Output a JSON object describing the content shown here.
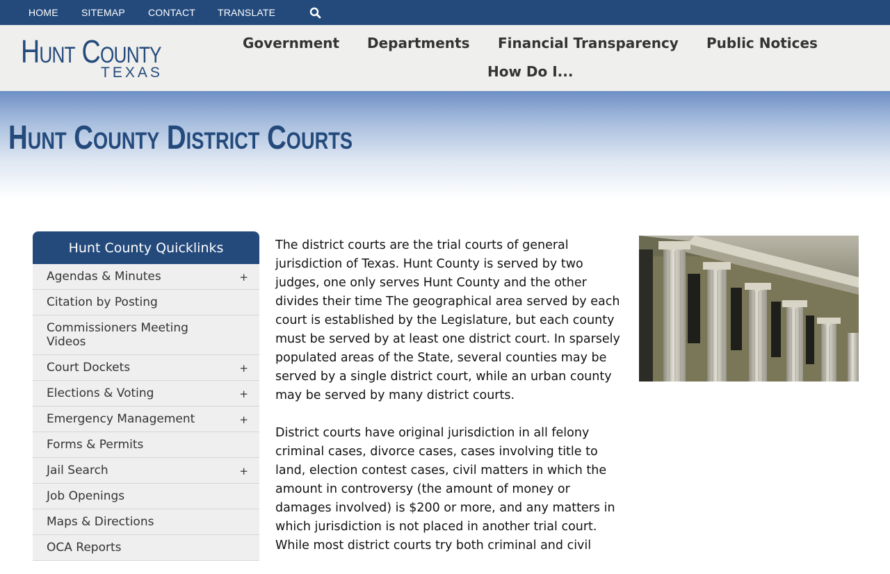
{
  "topbar": {
    "links": [
      "HOME",
      "SITEMAP",
      "CONTACT",
      "TRANSLATE"
    ]
  },
  "header": {
    "logo_main": "Hunt County",
    "logo_sub": "TEXAS",
    "nav": [
      "Government",
      "Departments",
      "Financial Transparency",
      "Public Notices",
      "How Do I..."
    ]
  },
  "banner": {
    "title": "Hunt County District Courts"
  },
  "sidebar": {
    "title": "Hunt County Quicklinks",
    "items": [
      {
        "label": "Agendas & Minutes",
        "expand": "+"
      },
      {
        "label": "Citation by Posting",
        "expand": ""
      },
      {
        "label": "Commissioners Meeting Videos",
        "expand": ""
      },
      {
        "label": "Court Dockets",
        "expand": "+"
      },
      {
        "label": "Elections & Voting",
        "expand": "+"
      },
      {
        "label": "Emergency Management",
        "expand": "+"
      },
      {
        "label": "Forms & Permits",
        "expand": ""
      },
      {
        "label": "Jail Search",
        "expand": "+"
      },
      {
        "label": "Job Openings",
        "expand": ""
      },
      {
        "label": "Maps & Directions",
        "expand": ""
      },
      {
        "label": "OCA Reports",
        "expand": ""
      }
    ]
  },
  "content": {
    "paragraphs": [
      "The district courts are the trial courts of general jurisdiction of Texas. Hunt County is served by two judges, one only serves Hunt County and the other divides their time The geographical area served by each court is established by the Legislature, but each county must be served by at least one district court. In sparsely populated areas of the State, several counties may be served by a single district court, while an urban county may be served by many district courts.",
      "District courts have original jurisdiction in all felony criminal cases, divorce cases, cases involving title to land, election contest cases, civil matters in which the amount in controversy (the amount of money or damages involved) is $200 or more, and any matters in which jurisdiction is not placed in another trial court. While most district courts try both criminal and civil"
    ]
  },
  "colors": {
    "brand": "#244a7c",
    "header_bg": "#efefed",
    "sidebar_item_bg": "#efefef"
  }
}
